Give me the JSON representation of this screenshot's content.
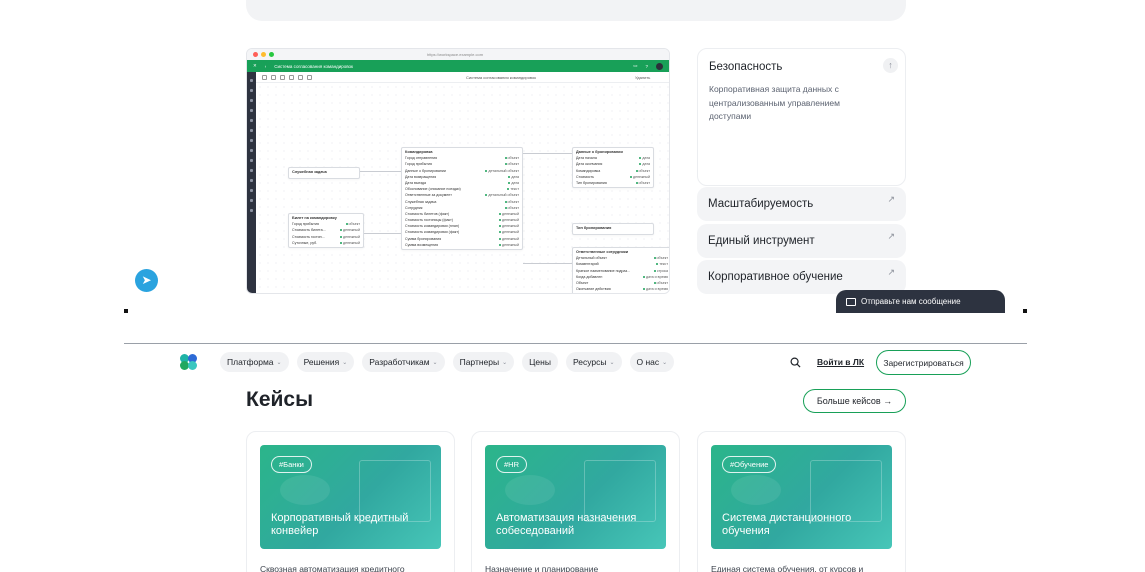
{
  "preview": {
    "url": "https://workspace.example.com",
    "app_title": "Система согласования командировок",
    "toolbar_title": "Система согласования командировок",
    "toolbar_right": "Удалить",
    "nodes": {
      "left_small": {
        "title": "Служебная задача"
      },
      "left_table": {
        "title": "Билет на командировку",
        "rows": [
          [
            "Город прибытия",
            "объект"
          ],
          [
            "Стоимость билета...",
            "денежный"
          ],
          [
            "Стоимость гостин...",
            "денежный"
          ],
          [
            "Суточные, руб.",
            "денежный"
          ]
        ]
      },
      "center": {
        "title": "Командировка",
        "rows": [
          [
            "Город отправления",
            "объект"
          ],
          [
            "Город прибытия",
            "объект"
          ],
          [
            "Данные о бронировании",
            "детальный объект"
          ],
          [
            "Дата возвращения",
            "дата"
          ],
          [
            "Дата выезда",
            "дата"
          ],
          [
            "Обоснование (описание поездки)",
            "текст"
          ],
          [
            "Ответственные за документ",
            "детальный объект"
          ],
          [
            "Служебная задача",
            "объект"
          ],
          [
            "Сотрудник",
            "объект"
          ],
          [
            "Стоимость билетов (факт)",
            "денежный"
          ],
          [
            "Стоимость гостиницы (факт)",
            "денежный"
          ],
          [
            "Стоимость командировки (план)",
            "денежный"
          ],
          [
            "Стоимость командировки (факт)",
            "денежный"
          ],
          [
            "Сумма бронирования",
            "денежный"
          ],
          [
            "Сумма возмещения",
            "денежный"
          ]
        ]
      },
      "right_top": {
        "title": "Данные о бронировании",
        "rows": [
          [
            "Дата начала",
            "дата"
          ],
          [
            "Дата окончания",
            "дата"
          ],
          [
            "Командировка",
            "объект"
          ],
          [
            "Стоимость",
            "денежный"
          ],
          [
            "Тип бронирования",
            "объект"
          ]
        ]
      },
      "right_mid": {
        "title": "Тип бронирования"
      },
      "right_bottom": {
        "title": "Ответственные сотрудники",
        "rows": [
          [
            "Детальный объект",
            "объект"
          ],
          [
            "Комментарий",
            "текст"
          ],
          [
            "Краткое наименование подраз...",
            "строка"
          ],
          [
            "Когда добавлен",
            "дата и время"
          ],
          [
            "Объект",
            "объект"
          ],
          [
            "Окончание действия",
            "дата и время"
          ],
          [
            "Роль",
            "объект"
          ]
        ]
      }
    }
  },
  "features": {
    "main": {
      "title": "Безопасность",
      "description": "Корпоративная защита данных с централизованным управлением доступами"
    },
    "items": [
      {
        "label": "Масштабируемость"
      },
      {
        "label": "Единый инструмент"
      },
      {
        "label": "Корпоративное обучение"
      }
    ],
    "arrow_up": "↑",
    "arrow": "↗"
  },
  "message_button": "Отправьте нам сообщение",
  "nav": {
    "items": [
      {
        "label": "Платформа",
        "dropdown": true
      },
      {
        "label": "Решения",
        "dropdown": true
      },
      {
        "label": "Разработчикам",
        "dropdown": true
      },
      {
        "label": "Партнеры",
        "dropdown": true
      },
      {
        "label": "Цены",
        "dropdown": false
      },
      {
        "label": "Ресурсы",
        "dropdown": true
      },
      {
        "label": "О нас",
        "dropdown": true
      }
    ],
    "chevron": "⌄",
    "login": "Войти в ЛК",
    "register": "Зарегистрироваться"
  },
  "cases": {
    "title": "Кейсы",
    "more": "Больше кейсов →",
    "items": [
      {
        "tag": "#Банки",
        "title": "Корпоративный кредитный конвейер",
        "description": "Сквозная автоматизация кредитного"
      },
      {
        "tag": "#HR",
        "title": "Автоматизация назначения собеседований",
        "description": "Назначение и планирование"
      },
      {
        "tag": "#Обучение",
        "title": "Система дистанционного обучения",
        "description": "Единая система обучения, от курсов и"
      }
    ]
  },
  "colors": {
    "accent": "#18a058",
    "telegram": "#2aa3df",
    "dark": "#2d3340"
  }
}
